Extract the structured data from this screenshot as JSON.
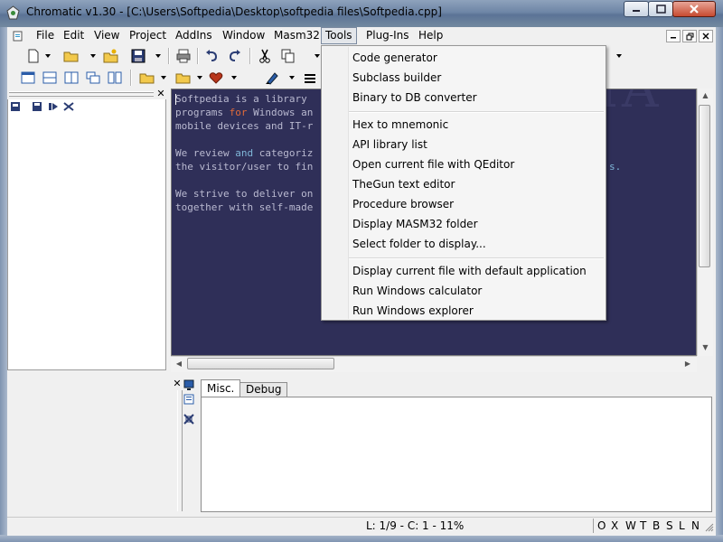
{
  "window": {
    "title": "Chromatic v1.30 - [C:\\Users\\Softpedia\\Desktop\\softpedia files\\Softpedia.cpp]"
  },
  "menubar": {
    "items": [
      "File",
      "Edit",
      "View",
      "Project",
      "AddIns",
      "Window",
      "Masm32",
      "Tools",
      "Plug-Ins",
      "Help"
    ],
    "active": "Tools"
  },
  "editor": {
    "lines": [
      "Softpedia is a library",
      "programs for Windows an",
      "mobile devices and IT-r",
      "",
      "We review and categoriz",
      "the visitor/user to fin",
      "",
      "We strive to deliver on",
      "together with self-made"
    ],
    "right_fragment_1": "s.",
    "watermark": "SOFTPEDIA"
  },
  "tools_menu": {
    "groups": [
      [
        "Code generator",
        "Subclass builder",
        "Binary to DB converter"
      ],
      [
        "Hex to mnemonic",
        "API library list",
        "Open current file with QEditor",
        "TheGun text editor",
        "Procedure browser",
        "Display MASM32 folder",
        "Select folder to display..."
      ],
      [
        "Display current file with default application",
        "Run Windows calculator",
        "Run Windows explorer"
      ]
    ]
  },
  "bottom_panel": {
    "tabs": [
      "Misc.",
      "Debug"
    ],
    "active_tab": "Misc."
  },
  "statusbar": {
    "position": "L: 1/9 - C: 1 - 11%",
    "flags": [
      "O",
      "X",
      "W",
      "T",
      "B",
      "S",
      "L",
      "N"
    ]
  },
  "colors": {
    "editor_bg": "#2f2f58",
    "editor_text": "#b9b9d0",
    "keyword": "#e06a3a"
  }
}
